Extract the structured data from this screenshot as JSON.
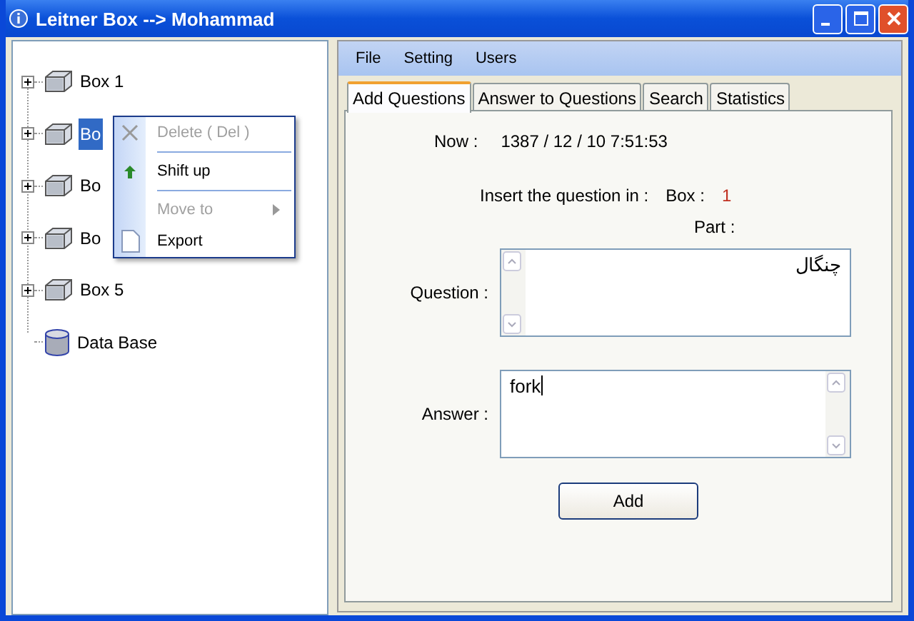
{
  "window": {
    "title": "Leitner Box --> Mohammad"
  },
  "tree": {
    "items": [
      {
        "label": "Box 1",
        "kind": "box",
        "selected": false
      },
      {
        "label": "Bo",
        "kind": "box",
        "selected": true
      },
      {
        "label": "Bo",
        "kind": "box",
        "selected": false
      },
      {
        "label": "Bo",
        "kind": "box",
        "selected": false
      },
      {
        "label": "Box 5",
        "kind": "box",
        "selected": false
      },
      {
        "label": "Data Base",
        "kind": "database",
        "selected": false
      }
    ]
  },
  "context_menu": {
    "items": [
      {
        "kind": "delete",
        "label": "Delete ( Del )",
        "disabled": true,
        "submenu": false
      },
      {
        "kind": "separator"
      },
      {
        "kind": "shift-up",
        "label": "Shift up",
        "disabled": false,
        "submenu": false
      },
      {
        "kind": "separator"
      },
      {
        "kind": "plain",
        "label": "Move to",
        "disabled": true,
        "submenu": true
      },
      {
        "kind": "export",
        "label": "Export",
        "disabled": false,
        "submenu": false
      }
    ]
  },
  "menu_bar": [
    "File",
    "Setting",
    "Users"
  ],
  "tabs": [
    {
      "label": "Add Questions",
      "selected": true
    },
    {
      "label": "Answer to Questions",
      "selected": false
    },
    {
      "label": "Search",
      "selected": false
    },
    {
      "label": "Statistics",
      "selected": false
    }
  ],
  "form": {
    "now_label": "Now :",
    "now_value": "1387 / 12 / 10   7:51:53",
    "insert_label": "Insert the question in :",
    "box_label": "Box :",
    "box_value": "1",
    "part_label": "Part :",
    "question_label": "Question :",
    "question_value": "چنگال",
    "answer_label": "Answer :",
    "answer_value": "fork",
    "add_button": "Add"
  }
}
